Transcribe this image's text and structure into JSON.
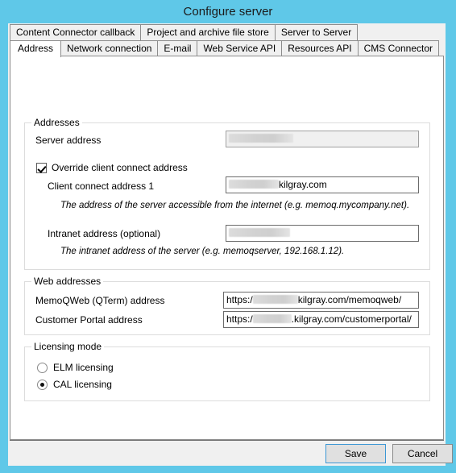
{
  "window": {
    "title": "Configure server"
  },
  "tabs": {
    "row1": [
      {
        "label": "Content Connector callback",
        "active": false
      },
      {
        "label": "Project and archive file store",
        "active": false
      },
      {
        "label": "Server to Server",
        "active": false
      }
    ],
    "row2": [
      {
        "label": "Address",
        "active": true
      },
      {
        "label": "Network connection",
        "active": false
      },
      {
        "label": "E-mail",
        "active": false
      },
      {
        "label": "Web Service API",
        "active": false
      },
      {
        "label": "Resources API",
        "active": false
      },
      {
        "label": "CMS Connector",
        "active": false
      }
    ]
  },
  "addresses": {
    "legend": "Addresses",
    "server_address_label": "Server address",
    "server_address_value": "",
    "override_checkbox_label": "Override client connect address",
    "override_checked": true,
    "client_connect_label": "Client connect address 1",
    "client_connect_value": "kilgray.com",
    "client_connect_hint": "The address of the server accessible from the internet (e.g. memoq.mycompany.net).",
    "intranet_label": "Intranet address (optional)",
    "intranet_value": "",
    "intranet_hint": "The intranet address of the server (e.g. memoqserver, 192.168.1.12)."
  },
  "web_addresses": {
    "legend": "Web addresses",
    "memoqweb_label": "MemoQWeb (QTerm) address",
    "memoqweb_prefix": "https:/",
    "memoqweb_suffix": "kilgray.com/memoqweb/",
    "portal_label": "Customer Portal address",
    "portal_prefix": "https:/",
    "portal_suffix": ".kilgray.com/customerportal/"
  },
  "licensing": {
    "legend": "Licensing mode",
    "options": [
      {
        "label": "ELM licensing",
        "selected": false
      },
      {
        "label": "CAL licensing",
        "selected": true
      }
    ]
  },
  "footer": {
    "save_label": "Save",
    "cancel_label": "Cancel"
  },
  "colors": {
    "titlebar": "#5fc8e8",
    "dialog": "#f0f0f0",
    "panel": "#ffffff",
    "default_button_border": "#3c97d4"
  }
}
